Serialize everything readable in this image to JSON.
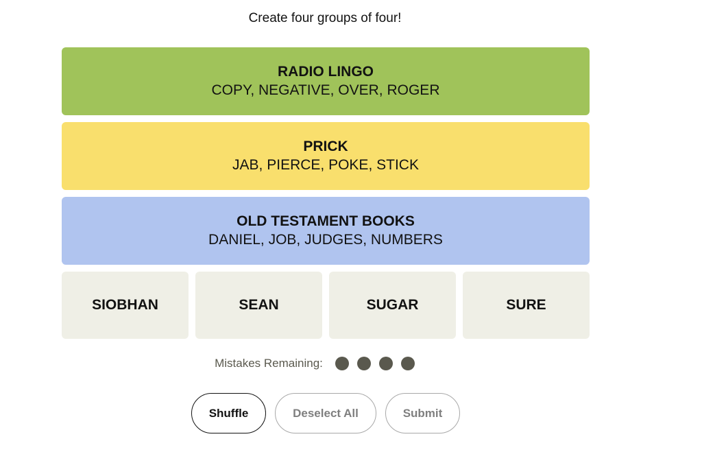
{
  "instructions": "Create four groups of four!",
  "solved_groups": [
    {
      "title": "RADIO LINGO",
      "members": "COPY, NEGATIVE, OVER, ROGER",
      "color": "#a0c35a"
    },
    {
      "title": "PRICK",
      "members": "JAB, PIERCE, POKE, STICK",
      "color": "#f9df6d"
    },
    {
      "title": "OLD TESTAMENT BOOKS",
      "members": "DANIEL, JOB, JUDGES, NUMBERS",
      "color": "#b0c4ef"
    }
  ],
  "tiles": [
    "SIOBHAN",
    "SEAN",
    "SUGAR",
    "SURE"
  ],
  "tile_color": "#efefe6",
  "mistakes": {
    "label": "Mistakes Remaining:",
    "remaining": 4,
    "dot_color": "#5a594e"
  },
  "buttons": {
    "shuffle": "Shuffle",
    "deselect_all": "Deselect All",
    "submit": "Submit"
  }
}
